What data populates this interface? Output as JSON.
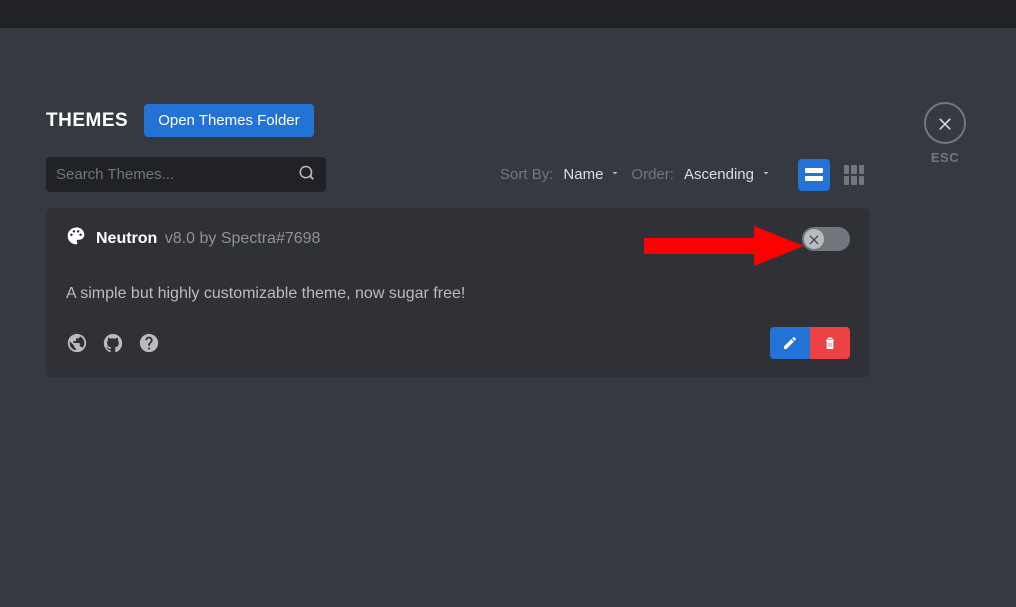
{
  "header": {
    "title": "THEMES",
    "open_folder_label": "Open Themes Folder"
  },
  "search": {
    "placeholder": "Search Themes..."
  },
  "sort": {
    "sort_by_label": "Sort By:",
    "sort_by_value": "Name",
    "order_label": "Order:",
    "order_value": "Ascending"
  },
  "theme": {
    "name": "Neutron",
    "meta": "v8.0 by Spectra#7698",
    "description": "A simple but highly customizable theme, now sugar free!"
  },
  "close": {
    "label": "ESC"
  }
}
